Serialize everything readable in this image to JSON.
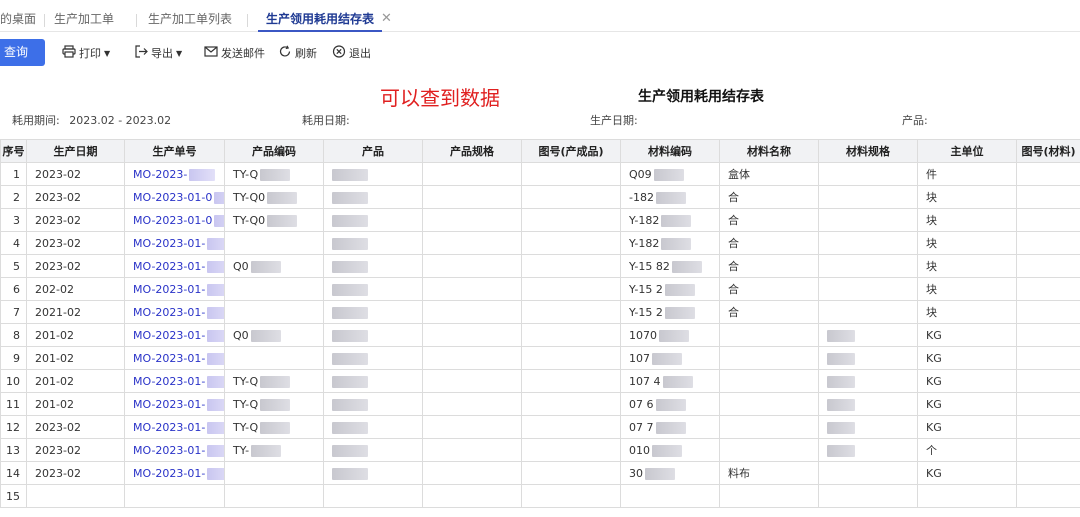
{
  "tabs": [
    {
      "label": "的桌面",
      "active": false
    },
    {
      "label": "生产加工单",
      "active": false
    },
    {
      "label": "生产加工单列表",
      "active": false
    },
    {
      "label": "生产领用耗用结存表",
      "active": true
    }
  ],
  "toolbar": {
    "query": "查询",
    "print": "打印",
    "export": "导出",
    "send_mail": "发送邮件",
    "refresh": "刷新",
    "exit": "退出"
  },
  "hint": "可以查到数据",
  "report_title": "生产领用耗用结存表",
  "filters": {
    "period_label": "耗用期间:",
    "period_value": "2023.02 - 2023.02",
    "consume_date_label": "耗用日期:",
    "production_date_label": "生产日期:",
    "product_label": "产品:"
  },
  "columns": [
    "序号",
    "生产日期",
    "生产单号",
    "产品编码",
    "产品",
    "产品规格",
    "图号(产成品)",
    "材料编码",
    "材料名称",
    "材料规格",
    "主单位",
    "图号(材料)"
  ],
  "rows": [
    {
      "no": "1",
      "date": "2023-02",
      "order": "MO-2023-",
      "pcode": "TY-Q",
      "mcode": "Q09",
      "mname": "盒体",
      "unit": "件"
    },
    {
      "no": "2",
      "date": "2023-02",
      "order": "MO-2023-01-0",
      "pcode": "TY-Q0",
      "mcode": "-182",
      "mname": "合",
      "unit": "块"
    },
    {
      "no": "3",
      "date": "2023-02",
      "order": "MO-2023-01-0",
      "pcode": "TY-Q0",
      "mcode": "Y-182",
      "mname": "合",
      "unit": "块"
    },
    {
      "no": "4",
      "date": "2023-02",
      "order": "MO-2023-01-",
      "pcode": "",
      "mcode": "Y-182",
      "mname": "合",
      "unit": "块"
    },
    {
      "no": "5",
      "date": "2023-02",
      "order": "MO-2023-01-",
      "pcode": "Q0",
      "mcode": "Y-15 82",
      "mname": "合",
      "unit": "块"
    },
    {
      "no": "6",
      "date": "202-02",
      "order": "MO-2023-01-",
      "pcode": "",
      "mcode": "Y-15 2",
      "mname": "合",
      "unit": "块"
    },
    {
      "no": "7",
      "date": "2021-02",
      "order": "MO-2023-01-",
      "pcode": "",
      "mcode": "Y-15 2",
      "mname": "合",
      "unit": "块"
    },
    {
      "no": "8",
      "date": "201-02",
      "order": "MO-2023-01-",
      "pcode": "Q0",
      "mcode": "1070",
      "mname": "",
      "unit": "KG"
    },
    {
      "no": "9",
      "date": "201-02",
      "order": "MO-2023-01-",
      "pcode": "",
      "mcode": "107",
      "mname": "",
      "unit": "KG"
    },
    {
      "no": "10",
      "date": "201-02",
      "order": "MO-2023-01-",
      "pcode": "TY-Q",
      "mcode": "107 4",
      "mname": "",
      "unit": "KG"
    },
    {
      "no": "11",
      "date": "201-02",
      "order": "MO-2023-01-",
      "pcode": "TY-Q",
      "mcode": "07 6",
      "mname": "",
      "unit": "KG"
    },
    {
      "no": "12",
      "date": "2023-02",
      "order": "MO-2023-01-",
      "pcode": "TY-Q",
      "mcode": "07 7",
      "mname": "",
      "unit": "KG"
    },
    {
      "no": "13",
      "date": "2023-02",
      "order": "MO-2023-01-",
      "pcode": "TY-",
      "mcode": "010",
      "mname": "",
      "unit": "个"
    },
    {
      "no": "14",
      "date": "2023-02",
      "order": "MO-2023-01-",
      "pcode": "",
      "mcode": "30",
      "mname": "料布",
      "unit": "KG"
    },
    {
      "no": "15",
      "date": "",
      "order": "",
      "pcode": "",
      "mcode": "",
      "mname": "",
      "unit": ""
    }
  ]
}
